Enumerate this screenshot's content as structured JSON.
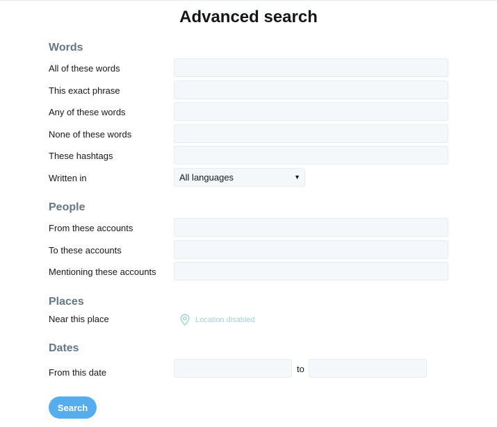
{
  "title": "Advanced search",
  "words": {
    "heading": "Words",
    "all_label": "All of these words",
    "exact_label": "This exact phrase",
    "any_label": "Any of these words",
    "none_label": "None of these words",
    "hashtags_label": "These hashtags",
    "written_in_label": "Written in",
    "language_value": "All languages"
  },
  "people": {
    "heading": "People",
    "from_label": "From these accounts",
    "to_label": "To these accounts",
    "mentioning_label": "Mentioning these accounts"
  },
  "places": {
    "heading": "Places",
    "near_label": "Near this place",
    "location_text": "Location disabled"
  },
  "dates": {
    "heading": "Dates",
    "from_label": "From this date",
    "to_text": "to"
  },
  "search_button": "Search",
  "colors": {
    "accent": "#55aded",
    "section_heading": "#657786",
    "field_bg": "#f5f8fa",
    "location_text": "#9fd4d9"
  }
}
